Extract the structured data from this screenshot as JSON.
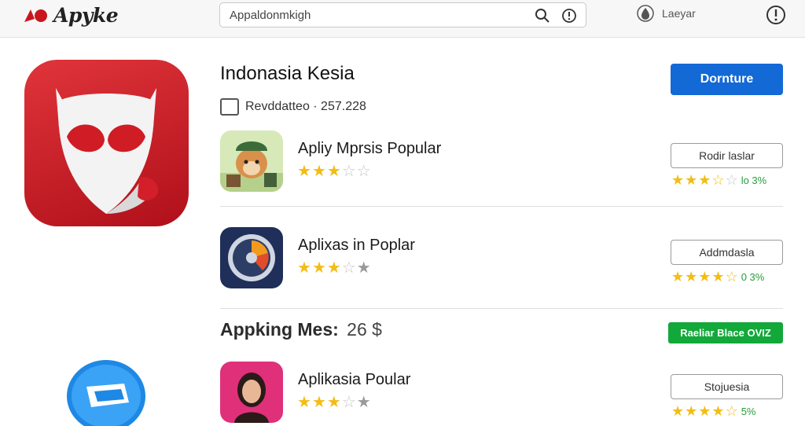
{
  "header": {
    "brand_name": "Apyke",
    "search_value": "Appaldonmkigh",
    "user_label": "Laeyar",
    "icons": [
      "brand-logo-icon",
      "search-icon",
      "info-circle-icon",
      "user-drop-icon",
      "alert-icon"
    ]
  },
  "featured": {
    "title": "Indonasia Kesia",
    "meta_text": "Revddatteo · 257.228",
    "primary_button": "Dornture"
  },
  "apps": [
    {
      "title": "Apliy Mprsis Popular",
      "rating_stars": 2.5,
      "button": "Rodir laslar",
      "button_rating_stars": 3.5,
      "percent": "lo 3%"
    },
    {
      "title": "Aplixas in Poplar",
      "rating_stars": 3,
      "button": "Addmdasla",
      "button_rating_stars": 4.5,
      "percent": "0 3%"
    },
    {
      "title": "Aplikasia Poular",
      "rating_stars": 2.5,
      "button": "Stojuesia",
      "button_rating_stars": 4.5,
      "percent": "5%"
    }
  ],
  "section": {
    "title": "Appking Mes:",
    "price": "26 $",
    "green_button": "Raeliar Blace OVIZ"
  },
  "colors": {
    "accent_blue": "#1369d6",
    "accent_green": "#13a83a",
    "star_gold": "#f2bd15",
    "brand_red": "#c8161e"
  }
}
